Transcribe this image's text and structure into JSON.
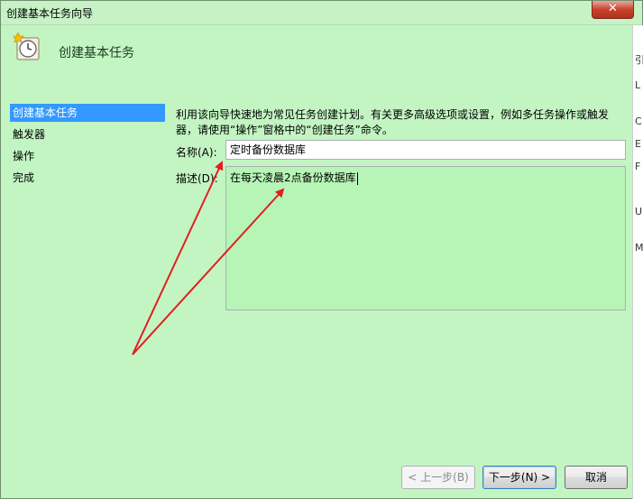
{
  "window": {
    "title": "创建基本任务向导",
    "close_label": "✕"
  },
  "header": {
    "title": "创建基本任务",
    "icon": "clock-icon"
  },
  "steps": [
    {
      "label": "创建基本任务",
      "active": true
    },
    {
      "label": "触发器",
      "active": false
    },
    {
      "label": "操作",
      "active": false
    },
    {
      "label": "完成",
      "active": false
    }
  ],
  "content": {
    "description": "利用该向导快速地为常见任务创建计划。有关更多高级选项或设置，例如多任务操作或触发器，请使用“操作”窗格中的“创建任务”命令。",
    "name_label": "名称(A):",
    "name_value": "定时备份数据库",
    "desc_label": "描述(D):",
    "desc_value": "在每天凌晨2点备份数据库"
  },
  "buttons": {
    "back": "< 上一步(B)",
    "next": "下一步(N) >",
    "cancel": "取消"
  },
  "right_strip": [
    "引",
    "L",
    "C",
    "E",
    "F",
    "U",
    "M"
  ],
  "annotation": {
    "color": "#e02020"
  },
  "colors": {
    "background": "#c3f5c3",
    "selection": "#3399ff"
  }
}
